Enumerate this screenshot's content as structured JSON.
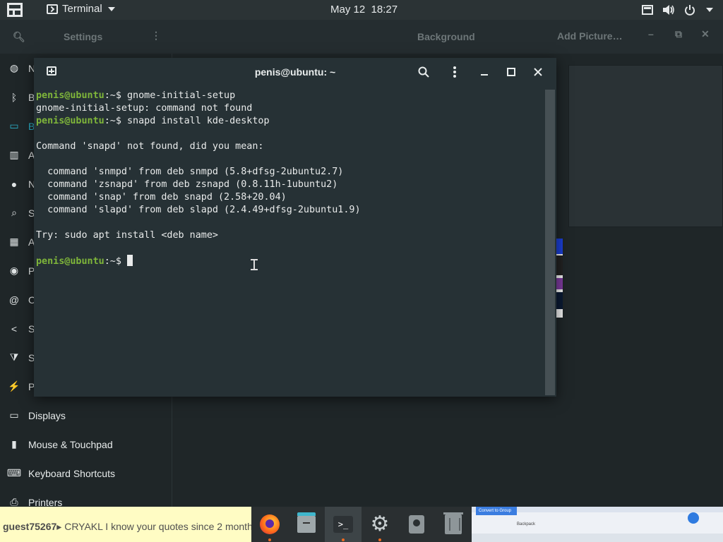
{
  "topbar": {
    "app_name": "Terminal",
    "date": "May 12",
    "time": "18:27",
    "tray_icons": [
      "screen-icon",
      "volume-icon",
      "power-icon",
      "chevron-down-icon"
    ]
  },
  "settings": {
    "title": "Settings",
    "panel_title": "Background",
    "add_picture_label": "Add Picture…",
    "sidebar": [
      {
        "label": "Network",
        "icon": "network-icon"
      },
      {
        "label": "Bluetooth",
        "icon": "bluetooth-icon"
      },
      {
        "label": "Background",
        "icon": "background-icon",
        "active": true
      },
      {
        "label": "Appearance",
        "icon": "appearance-icon"
      },
      {
        "label": "Notifications",
        "icon": "notifications-icon"
      },
      {
        "label": "Search",
        "icon": "search-icon"
      },
      {
        "label": "Applications",
        "icon": "applications-icon"
      },
      {
        "label": "Privacy",
        "icon": "privacy-icon"
      },
      {
        "label": "Online Accounts",
        "icon": "online-accounts-icon"
      },
      {
        "label": "Sharing",
        "icon": "sharing-icon"
      },
      {
        "label": "Sound",
        "icon": "sound-icon"
      },
      {
        "label": "Power",
        "icon": "power-icon"
      },
      {
        "label": "Displays",
        "icon": "displays-icon"
      },
      {
        "label": "Mouse & Touchpad",
        "icon": "mouse-icon"
      },
      {
        "label": "Keyboard Shortcuts",
        "icon": "keyboard-icon"
      },
      {
        "label": "Printers",
        "icon": "printer-icon"
      }
    ]
  },
  "terminal": {
    "title": "penis@ubuntu: ~",
    "prompt_user": "penis@ubuntu",
    "prompt_suffix": ":~$ ",
    "lines": [
      {
        "type": "prompt",
        "text": "gnome-initial-setup"
      },
      {
        "type": "out",
        "text": "gnome-initial-setup: command not found"
      },
      {
        "type": "prompt",
        "text": "snapd install kde-desktop"
      },
      {
        "type": "out",
        "text": ""
      },
      {
        "type": "out",
        "text": "Command 'snapd' not found, did you mean:"
      },
      {
        "type": "out",
        "text": ""
      },
      {
        "type": "out",
        "text": "  command 'snmpd' from deb snmpd (5.8+dfsg-2ubuntu2.7)"
      },
      {
        "type": "out",
        "text": "  command 'zsnapd' from deb zsnapd (0.8.11h-1ubuntu2)"
      },
      {
        "type": "out",
        "text": "  command 'snap' from deb snapd (2.58+20.04)"
      },
      {
        "type": "out",
        "text": "  command 'slapd' from deb slapd (2.4.49+dfsg-2ubuntu1.9)"
      },
      {
        "type": "out",
        "text": ""
      },
      {
        "type": "out",
        "text": "Try: sudo apt install <deb name>"
      },
      {
        "type": "out",
        "text": ""
      },
      {
        "type": "prompt",
        "text": "",
        "cursor": true
      }
    ]
  },
  "chat": {
    "user": "guest75267",
    "message": "CRYAKL I know your quotes since 2 month"
  },
  "dock": [
    {
      "name": "firefox",
      "running": true
    },
    {
      "name": "files",
      "running": false
    },
    {
      "name": "terminal",
      "running": true,
      "active": true
    },
    {
      "name": "settings",
      "running": true
    },
    {
      "name": "disks",
      "running": false
    },
    {
      "name": "trash",
      "running": false
    }
  ],
  "thumbnail": {
    "tab_label": "Convert to Group",
    "text": "Backpack"
  }
}
